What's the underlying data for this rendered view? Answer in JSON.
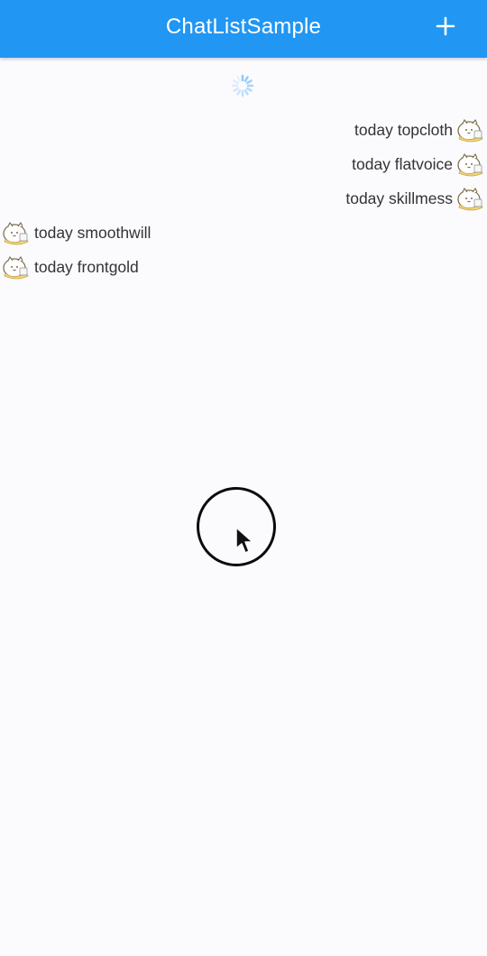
{
  "app": {
    "title": "ChatListSample",
    "add_icon": "plus-icon",
    "colors": {
      "app_bar": "#2196f3",
      "background": "#fbfbfe",
      "message_text": "#333333",
      "spinner": "#8fc8f8"
    }
  },
  "messages": [
    {
      "text": "today topcloth",
      "side": "right",
      "avatar_icon": "cat-avatar-icon"
    },
    {
      "text": "today flatvoice",
      "side": "right",
      "avatar_icon": "cat-avatar-icon"
    },
    {
      "text": "today skillmess",
      "side": "right",
      "avatar_icon": "cat-avatar-icon"
    },
    {
      "text": "today smoothwill",
      "side": "left",
      "avatar_icon": "cat-avatar-icon"
    },
    {
      "text": "today frontgold",
      "side": "left",
      "avatar_icon": "cat-avatar-icon"
    }
  ],
  "loading_indicator": "loading-spinner-icon",
  "pointer": {
    "icon": "mouse-pointer-icon",
    "touch_indicator": "touch-ring"
  }
}
